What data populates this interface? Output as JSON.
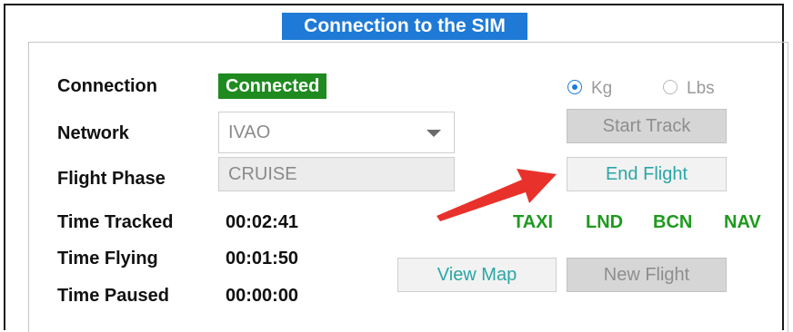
{
  "panel": {
    "title": "Connection to the SIM"
  },
  "labels": {
    "connection": "Connection",
    "network": "Network",
    "flight_phase": "Flight Phase",
    "time_tracked": "Time Tracked",
    "time_flying": "Time Flying",
    "time_paused": "Time Paused"
  },
  "status": {
    "connection": "Connected",
    "color": "#1f8a1f"
  },
  "network": {
    "value": "IVAO"
  },
  "flight_phase": {
    "value": "CRUISE"
  },
  "times": {
    "tracked": "00:02:41",
    "flying": "00:01:50",
    "paused": "00:00:00"
  },
  "units": {
    "kg": "Kg",
    "lbs": "Lbs",
    "selected": "Kg"
  },
  "buttons": {
    "start_track": "Start Track",
    "end_flight": "End Flight",
    "view_map": "View Map",
    "new_flight": "New Flight"
  },
  "indicators": [
    "TAXI",
    "LND",
    "BCN",
    "NAV"
  ],
  "colors": {
    "title_bg": "#1e7ad6",
    "indicator": "#1e9a1e",
    "annotation_arrow": "#e8312a"
  },
  "icons": {
    "dropdown": "chevron-down-icon",
    "annotation": "red-arrow-icon"
  }
}
